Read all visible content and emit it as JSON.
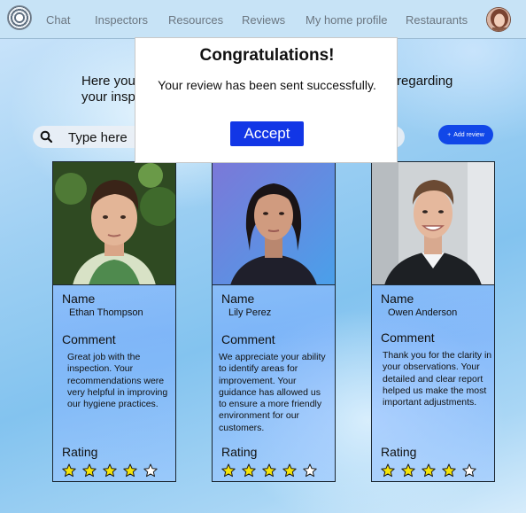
{
  "nav": {
    "items": [
      {
        "label": "Chat"
      },
      {
        "label": "Inspectors"
      },
      {
        "label": "Resources"
      },
      {
        "label": "Reviews"
      },
      {
        "label": "My home profile"
      },
      {
        "label": "Restaurants"
      }
    ]
  },
  "intro": {
    "text": "Here you can see the reviews that inspectors left you regarding your inspection."
  },
  "search": {
    "placeholder": "Type here",
    "value": ""
  },
  "add_review": {
    "icon": "plus-icon",
    "label": "Add review"
  },
  "labels": {
    "name": "Name",
    "comment": "Comment",
    "rating": "Rating"
  },
  "reviews": [
    {
      "name": "Ethan Thompson",
      "comment": "Great job with the inspection. Your recommendations were very helpful in improving our hygiene practices.",
      "rating": 4,
      "max_rating": 5
    },
    {
      "name": "Lily Perez",
      "comment": "We appreciate your ability to identify areas for improvement. Your guidance has allowed us to ensure a more friendly environment for our customers.",
      "rating": 4,
      "max_rating": 5
    },
    {
      "name": "Owen Anderson",
      "comment": "Thank you for the clarity in your observations. Your detailed and clear report helped us make the most important adjustments.",
      "rating": 4,
      "max_rating": 5
    }
  ],
  "modal": {
    "title": "Congratulations!",
    "message": "Your review has been sent successfully.",
    "accept_label": "Accept"
  },
  "colors": {
    "accent": "#1236e6",
    "star_filled": "#f5e50a",
    "star_empty": "#ffffff"
  }
}
